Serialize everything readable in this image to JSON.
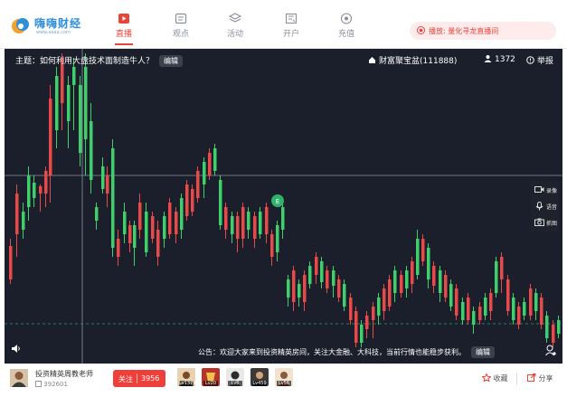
{
  "logo": {
    "name": "嗨嗨财经",
    "url": "www.aaaa.com"
  },
  "nav": [
    {
      "label": "直播",
      "icon": "live-icon",
      "active": true
    },
    {
      "label": "观点",
      "icon": "viewpoint-icon",
      "active": false
    },
    {
      "label": "活动",
      "icon": "activity-icon",
      "active": false
    },
    {
      "label": "开户",
      "icon": "account-icon",
      "active": false
    },
    {
      "label": "充值",
      "icon": "recharge-icon",
      "active": false
    }
  ],
  "now_playing": "播放: 量化寻龙直播间",
  "stage": {
    "topic": "主题：如何利用大盘技术面制造牛人？",
    "edit_label": "编辑",
    "room": "财富聚宝盆(111888)",
    "viewers": "1372",
    "report": "举报",
    "side_buttons": [
      "录像",
      "语音",
      "抓图"
    ],
    "notice": "公告：欢迎大家来到投资精英房间，关注大金融、大科技，当前行情也能稳步获利。",
    "notice_edit": "编辑",
    "marker_label": "E"
  },
  "footer": {
    "host_name": "投资精英周教老师",
    "host_id": "392601",
    "follow_label": "关注",
    "follow_count": "3956",
    "gifts": [
      {
        "level": "Lv1379"
      },
      {
        "level": "Lv20"
      },
      {
        "level": "Lv6"
      },
      {
        "level": "Lv459"
      },
      {
        "level": "Lv56"
      }
    ],
    "collect": "收藏",
    "share": "分享"
  },
  "colors": {
    "accent": "#e8443c",
    "up": "#e84a4a",
    "down": "#3fcf6b",
    "bg": "#1b1f2b"
  }
}
